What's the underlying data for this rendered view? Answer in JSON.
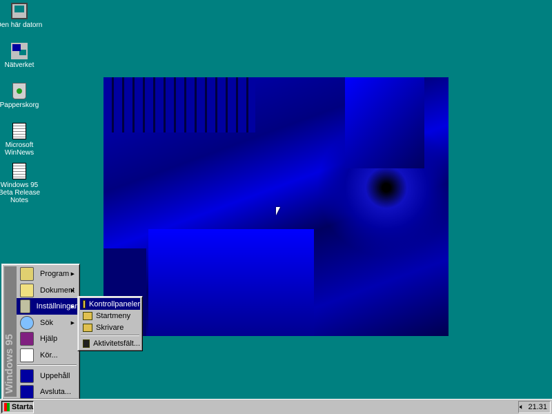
{
  "desktop_icons": [
    {
      "label": "Den här datorn",
      "icon": "my-computer-icon"
    },
    {
      "label": "Nätverket",
      "icon": "network-icon"
    },
    {
      "label": "Papperskorg",
      "icon": "recycle-bin-icon"
    },
    {
      "label": "Microsoft WinNews",
      "icon": "document-shortcut-icon"
    },
    {
      "label": "Windows 95 Beta Release Notes",
      "icon": "document-shortcut-icon"
    }
  ],
  "start_menu": {
    "banner": "Windows 95",
    "items": [
      {
        "label": "Program",
        "submenu": true
      },
      {
        "label": "Dokument",
        "submenu": true
      },
      {
        "label": "Inställningar",
        "submenu": true,
        "highlighted": true
      },
      {
        "label": "Sök",
        "submenu": true
      },
      {
        "label": "Hjälp"
      },
      {
        "label": "Kör..."
      },
      {
        "label": "Uppehåll"
      },
      {
        "label": "Avsluta..."
      }
    ],
    "settings_submenu": [
      {
        "label": "Kontrollpaneler",
        "highlighted": true
      },
      {
        "label": "Startmeny"
      },
      {
        "label": "Skrivare"
      },
      {
        "label": "Aktivitetsfält..."
      }
    ]
  },
  "taskbar": {
    "start_label": "Starta",
    "clock": "21.31"
  },
  "colors": {
    "desktop": "#008080",
    "highlight": "#000080",
    "face": "#c0c0c0"
  }
}
